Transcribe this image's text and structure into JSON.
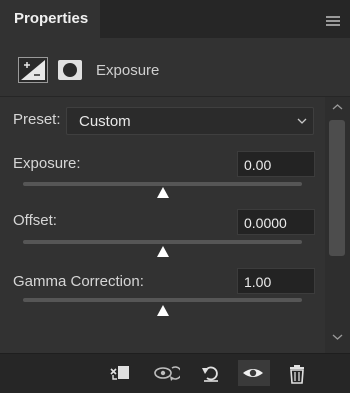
{
  "panel": {
    "title": "Properties",
    "header_title": "Exposure"
  },
  "preset": {
    "label": "Preset:",
    "value": "Custom"
  },
  "fields": [
    {
      "label": "Exposure:",
      "value": "0.00",
      "slider_fraction": 0.5
    },
    {
      "label": "Offset:",
      "value": "0.0000",
      "slider_fraction": 0.5
    },
    {
      "label": "Gamma Correction:",
      "value": "1.00",
      "slider_fraction": 0.5
    }
  ],
  "footer": {
    "buttons": [
      "clip-to-layer-icon",
      "view-previous-state-icon",
      "reset-icon",
      "visibility-icon",
      "trash-icon"
    ]
  },
  "colors": {
    "panel_bg": "#323232",
    "tab_bg": "#262626",
    "text": "#d6d6d6",
    "input_bg": "#232323"
  }
}
